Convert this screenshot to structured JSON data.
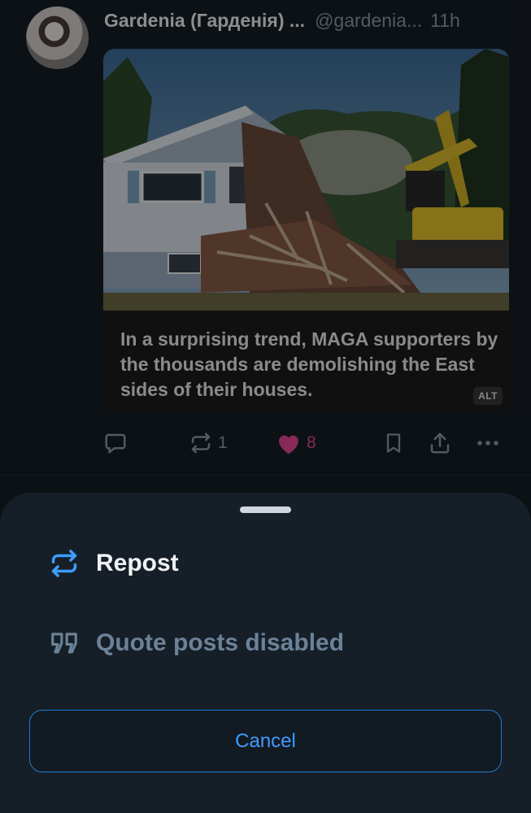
{
  "post": {
    "author": {
      "display_name": "Gardenia (Гарденія) ...",
      "handle": "@gardenia...",
      "timestamp": "11h"
    },
    "image": {
      "caption": "In a surprising trend, MAGA supporters by the thousands are demolishing the East sides of their houses.",
      "alt_badge": "ALT"
    },
    "actions": {
      "reply_icon": "reply-icon",
      "repost_icon": "repost-icon",
      "repost_count": "1",
      "like_icon": "heart-icon",
      "like_count": "8",
      "like_color": "#ec4899",
      "bookmark_icon": "bookmark-icon",
      "share_icon": "share-icon",
      "more_icon": "more-icon"
    }
  },
  "sheet": {
    "repost_label": "Repost",
    "quote_label": "Quote posts disabled",
    "cancel_label": "Cancel",
    "accent_color": "#3b9dff"
  }
}
